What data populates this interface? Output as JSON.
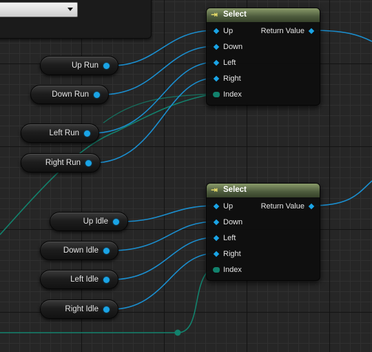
{
  "graph": {
    "variables": [
      {
        "id": "up_run",
        "label": "Up Run"
      },
      {
        "id": "down_run",
        "label": "Down Run"
      },
      {
        "id": "left_run",
        "label": "Left Run"
      },
      {
        "id": "right_run",
        "label": "Right Run"
      },
      {
        "id": "up_idle",
        "label": "Up Idle"
      },
      {
        "id": "down_idle",
        "label": "Down Idle"
      },
      {
        "id": "left_idle",
        "label": "Left Idle"
      },
      {
        "id": "right_idle",
        "label": "Right Idle"
      }
    ],
    "select_nodes": [
      {
        "title": "Select",
        "inputs": [
          "Up",
          "Down",
          "Left",
          "Right",
          "Index"
        ],
        "output": "Return Value"
      },
      {
        "title": "Select",
        "inputs": [
          "Up",
          "Down",
          "Left",
          "Right",
          "Index"
        ],
        "output": "Return Value"
      }
    ]
  },
  "colors": {
    "background": "#262626",
    "object_pin": "#1aa4e6",
    "index_pin": "#12826d",
    "select_header": "#4c5a3c"
  },
  "icons": {
    "select_icon": "select-function-icon",
    "dropdown_arrow": "chevron-down-icon"
  }
}
